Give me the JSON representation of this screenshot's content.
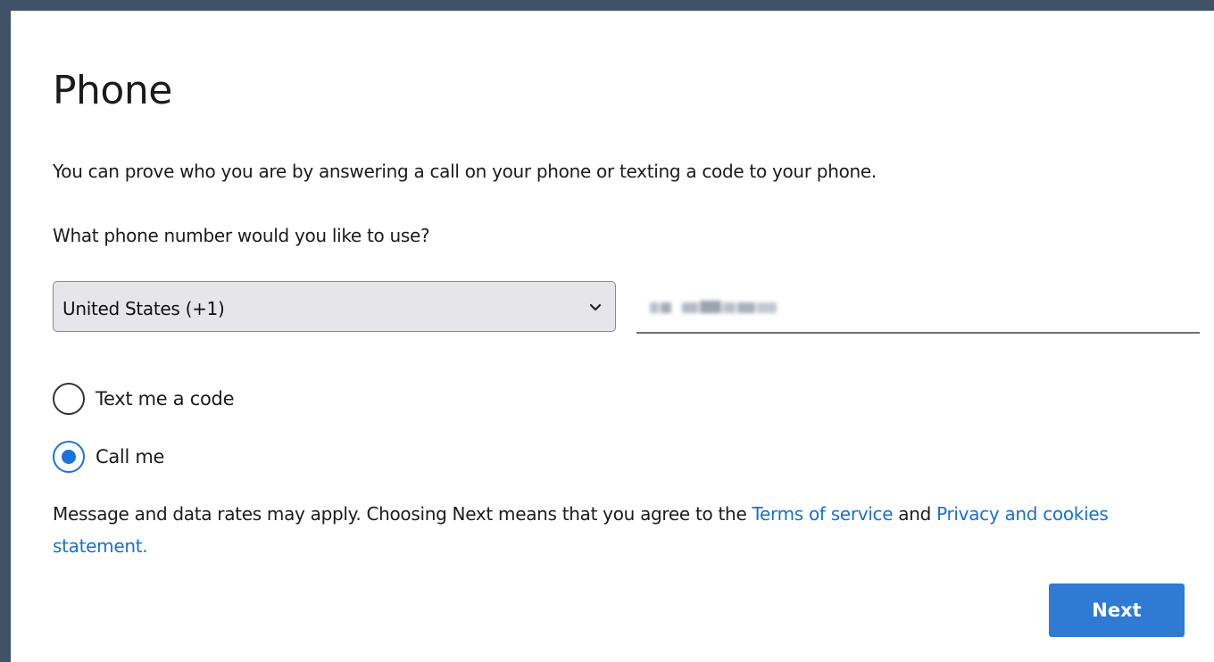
{
  "page": {
    "title": "Phone",
    "intro": "You can prove who you are by answering a call on your phone or texting a code to your phone.",
    "question": "What phone number would you like to use?"
  },
  "country_select": {
    "selected": "United States (+1)",
    "icon": "chevron-down-icon"
  },
  "phone_input": {
    "value_redacted": true
  },
  "methods": [
    {
      "label": "Text me a code",
      "checked": false
    },
    {
      "label": "Call me",
      "checked": true
    }
  ],
  "legal": {
    "text_before": "Message and data rates may apply. Choosing Next means that you agree to the ",
    "terms_link": "Terms of service",
    "and_text": " and ",
    "privacy_link": "Privacy and cookies statement."
  },
  "actions": {
    "next_label": "Next"
  },
  "colors": {
    "accent": "#2f7ad3",
    "link": "#1a6fd1",
    "background": "#3f5266"
  }
}
